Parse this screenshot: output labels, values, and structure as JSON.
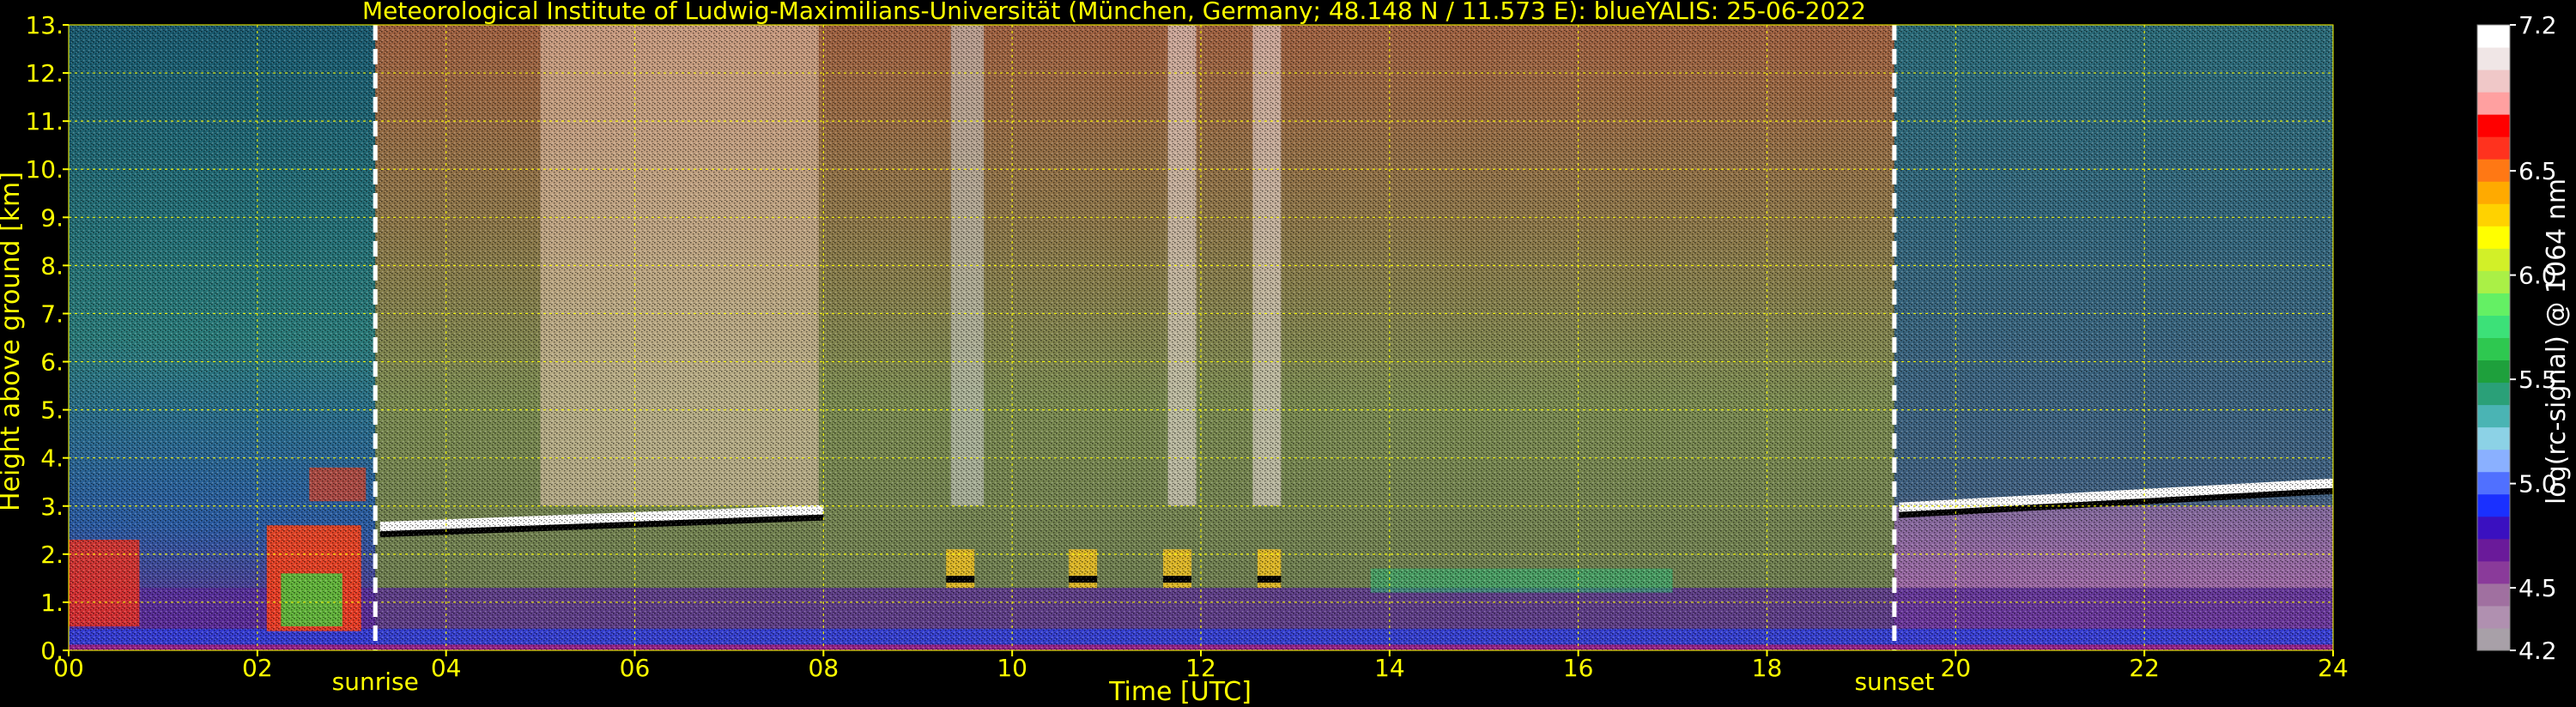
{
  "chart_data": {
    "type": "heatmap",
    "title": "Meteorological Institute of Ludwig-Maximilians-Universität (München, Germany; 48.148 N / 11.573 E):    blueYALIS: 25-06-2022",
    "xlabel": "Time [UTC]",
    "ylabel": "Height above ground [km]",
    "xlim": [
      0,
      24
    ],
    "ylim": [
      0,
      13
    ],
    "x_ticks": [
      "00",
      "02",
      "04",
      "06",
      "08",
      "10",
      "12",
      "14",
      "16",
      "18",
      "20",
      "22",
      "24"
    ],
    "y_ticks": [
      "0.",
      "1.",
      "2.",
      "3.",
      "4.",
      "5.",
      "6.",
      "7.",
      "8.",
      "9.",
      "10.",
      "11.",
      "12.",
      "13."
    ],
    "grid": true,
    "grid_style": "dotted",
    "grid_color": "#ffff00",
    "events": [
      {
        "label": "sunrise",
        "time": 3.25
      },
      {
        "label": "sunset",
        "time": 19.35
      }
    ],
    "cloud_layers": [
      {
        "start": 3.3,
        "end": 8.0,
        "height_start": 2.6,
        "height_end": 2.95
      },
      {
        "start": 19.4,
        "end": 24.0,
        "height_start": 3.0,
        "height_end": 3.5
      }
    ],
    "colorbar": {
      "label": "log(rc-signal) @ 1064 nm",
      "min": 4.2,
      "max": 7.2,
      "ticks": [
        "4.2",
        "4.5",
        "5.0",
        "5.5",
        "6.0",
        "6.5",
        "7.2"
      ],
      "tick_values": [
        4.2,
        4.5,
        5.0,
        5.5,
        6.0,
        6.5,
        7.2
      ],
      "colors": [
        "#a8a0a8",
        "#b090b0",
        "#a070a0",
        "#8a3a9a",
        "#6a1a9a",
        "#3a10c0",
        "#1a30ff",
        "#5070ff",
        "#8ab0ff",
        "#8cd2e6",
        "#4ab4b4",
        "#2aa078",
        "#1ea03c",
        "#2ec850",
        "#3ce178",
        "#64f064",
        "#aaf046",
        "#d2f028",
        "#ffff00",
        "#ffd200",
        "#ffaa00",
        "#ff7814",
        "#ff321e",
        "#ff0000",
        "#ffa0a0",
        "#f0c8c8",
        "#f0e6e6",
        "#ffffff"
      ]
    }
  }
}
